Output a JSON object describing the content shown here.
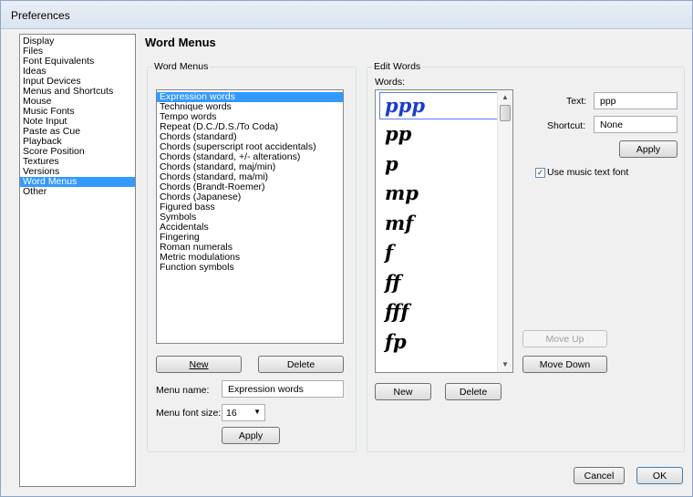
{
  "window": {
    "title": "Preferences"
  },
  "nav": {
    "items": [
      "Display",
      "Files",
      "Font Equivalents",
      "Ideas",
      "Input Devices",
      "Menus and Shortcuts",
      "Mouse",
      "Music Fonts",
      "Note Input",
      "Paste as Cue",
      "Playback",
      "Score Position",
      "Textures",
      "Versions",
      "Word Menus",
      "Other"
    ],
    "selected_index": 14
  },
  "page_title": "Word Menus",
  "word_menus": {
    "group_label": "Word Menus",
    "items": [
      "Expression words",
      "Technique words",
      "Tempo words",
      "Repeat (D.C./D.S./To Coda)",
      "Chords (standard)",
      "Chords (superscript root accidentals)",
      "Chords (standard, +/- alterations)",
      "Chords (standard, maj/min)",
      "Chords (standard, ma/mi)",
      "Chords (Brandt-Roemer)",
      "Chords (Japanese)",
      "Figured bass",
      "Symbols",
      "Accidentals",
      "Fingering",
      "Roman numerals",
      "Metric modulations",
      "Function symbols"
    ],
    "selected_index": 0,
    "new_label": "New",
    "delete_label": "Delete",
    "menu_name_label": "Menu name:",
    "menu_name_value": "Expression words",
    "menu_font_size_label": "Menu font size:",
    "menu_font_size_value": "16",
    "apply_label": "Apply"
  },
  "edit_words": {
    "group_label": "Edit Words",
    "words_label": "Words:",
    "words": [
      "ppp",
      "pp",
      "p",
      "mp",
      "mf",
      "f",
      "ff",
      "fff",
      "fp"
    ],
    "selected_index": 0,
    "new_label": "New",
    "delete_label": "Delete",
    "text_label": "Text:",
    "text_value": "ppp",
    "shortcut_label": "Shortcut:",
    "shortcut_value": "None",
    "apply_label": "Apply",
    "use_music_font_label": "Use music text font",
    "use_music_font_checked": true,
    "move_up_label": "Move Up",
    "move_down_label": "Move Down"
  },
  "footer": {
    "cancel_label": "Cancel",
    "ok_label": "OK"
  }
}
